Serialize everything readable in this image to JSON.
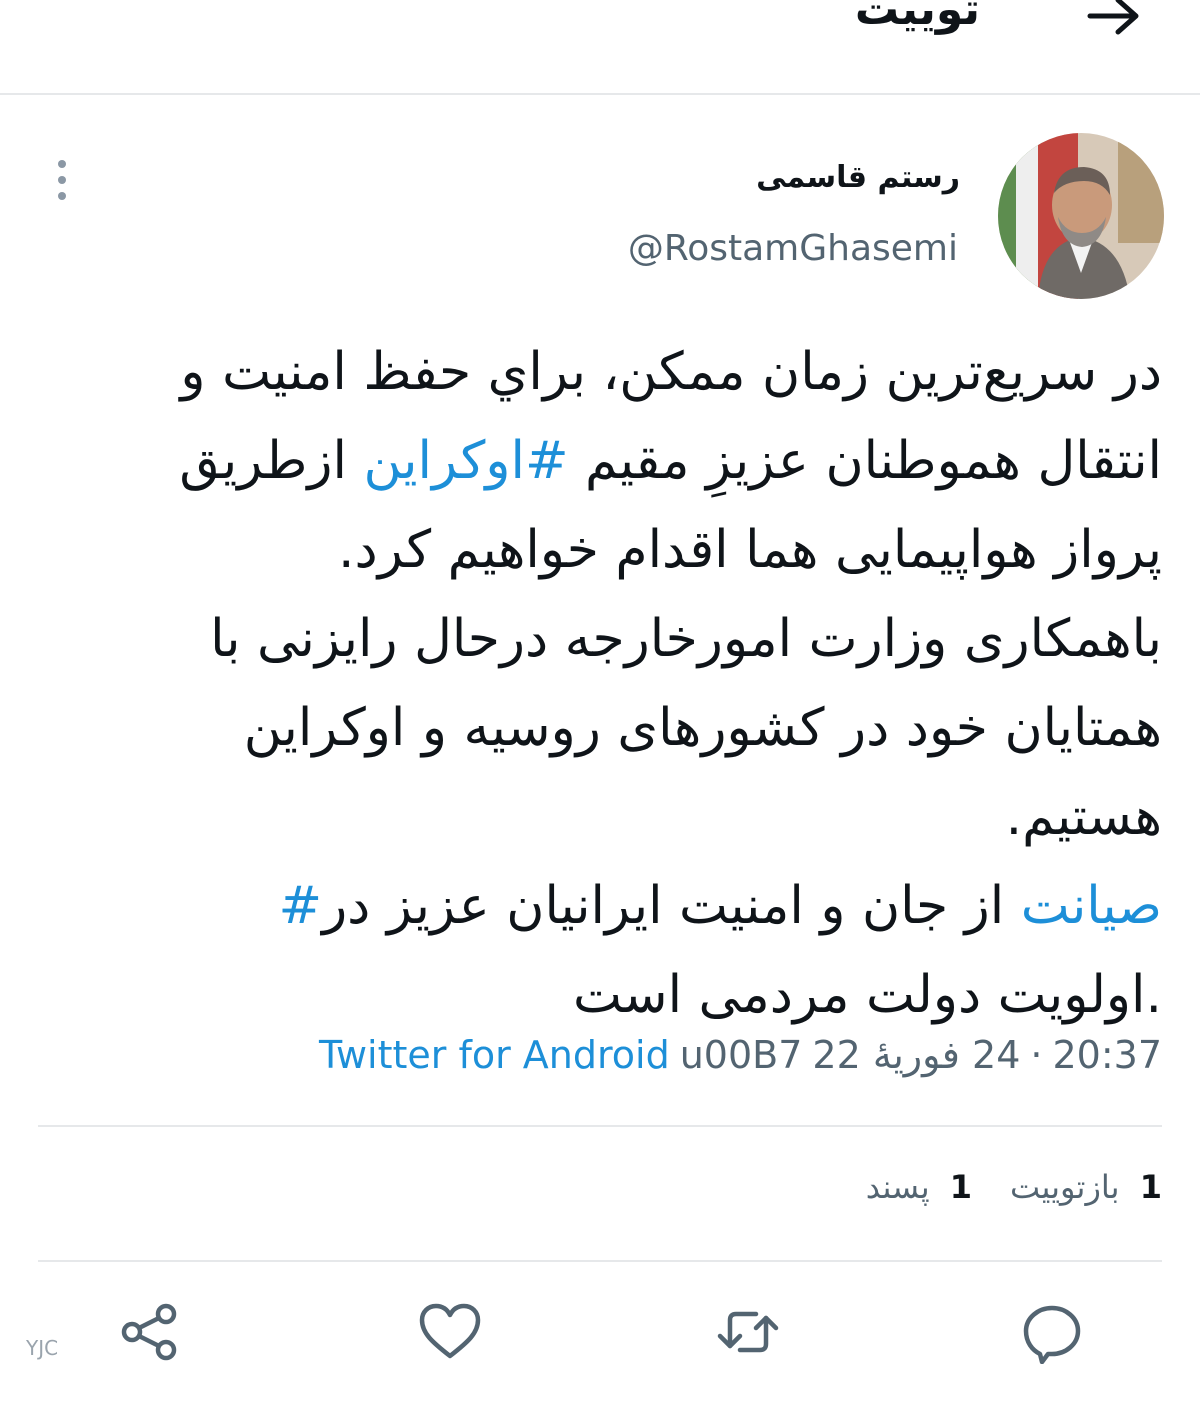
{
  "header": {
    "title": "توییت",
    "back_icon": "arrow-right-icon"
  },
  "author": {
    "display_name": "رستم قاسمی",
    "handle": "@RostamGhasemi"
  },
  "tweet": {
    "lines": [
      [
        "در سریع‌ترین زمان ممکن، براي حفظ امنیت و"
      ],
      [
        "انتقال هموطنان عزیزِ مقیم ",
        {
          "hashtag": "#اوکراین"
        },
        " ازطریق"
      ],
      [
        "پرواز هواپیمایی هما اقدام خواهیم کرد."
      ],
      [
        "باهمکاری وزارت امورخارجه درحال رایزنی با"
      ],
      [
        "همتایان خود در کشورهای روسیه و اوکراین"
      ],
      [
        "هستیم."
      ]
    ],
    "line7": {
      "hashtag_word": "صیانت",
      "text": " از جان و امنیت ایرانیان عزیز در",
      "hash_mark": "#"
    },
    "line8": ".اولویت دولت مردمی است"
  },
  "meta": {
    "time": "20:37",
    "separator": "·",
    "date": "24 فوریهٔ 22",
    "escape": "u00B7",
    "source": "Twitter for Android"
  },
  "stats": {
    "retweets_count": "1",
    "retweets_label": "بازتوییت",
    "likes_count": "1",
    "likes_label": "پسند"
  },
  "actions": {
    "reply_icon": "reply-icon",
    "retweet_icon": "retweet-icon",
    "like_icon": "heart-icon",
    "share_icon": "share-icon"
  },
  "watermark": "YJC",
  "colors": {
    "link": "#1d8fd8",
    "secondary_text": "#536471",
    "divider": "#e6e8ea"
  }
}
